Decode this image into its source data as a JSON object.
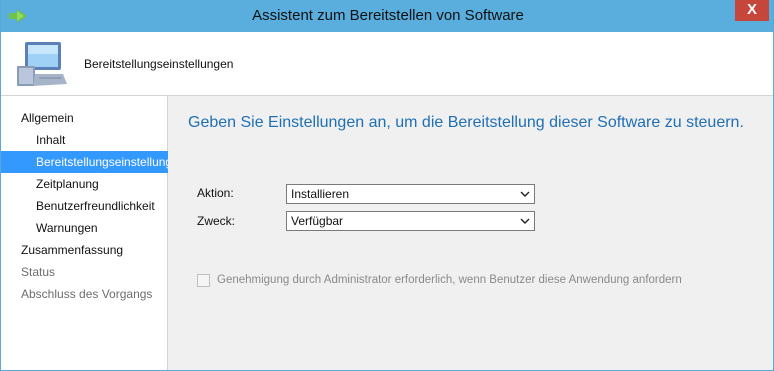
{
  "window": {
    "title": "Assistent zum Bereitstellen von Software",
    "close_label": "X"
  },
  "header": {
    "title": "Bereitstellungseinstellungen",
    "icon": "computer-icon"
  },
  "sidebar": {
    "items": [
      {
        "label": "Allgemein",
        "level": 1,
        "state": "normal"
      },
      {
        "label": "Inhalt",
        "level": 2,
        "state": "normal"
      },
      {
        "label": "Bereitstellungseinstellungen",
        "level": 2,
        "state": "selected"
      },
      {
        "label": "Zeitplanung",
        "level": 2,
        "state": "normal"
      },
      {
        "label": "Benutzerfreundlichkeit",
        "level": 2,
        "state": "normal"
      },
      {
        "label": "Warnungen",
        "level": 2,
        "state": "normal"
      },
      {
        "label": "Zusammenfassung",
        "level": 1,
        "state": "normal"
      },
      {
        "label": "Status",
        "level": 1,
        "state": "disabled"
      },
      {
        "label": "Abschluss des Vorgangs",
        "level": 1,
        "state": "disabled"
      }
    ]
  },
  "main": {
    "heading": "Geben Sie Einstellungen an, um die Bereitstellung dieser Software zu steuern.",
    "action_label": "Aktion:",
    "action_value": "Installieren",
    "purpose_label": "Zweck:",
    "purpose_value": "Verfügbar",
    "approval_label": "Genehmigung durch Administrator erforderlich, wenn Benutzer diese Anwendung anfordern",
    "approval_checked": false,
    "approval_enabled": false
  },
  "colors": {
    "titlebar": "#5aaede",
    "close": "#c7463b",
    "selection": "#3399ff",
    "heading": "#1f6fb5"
  }
}
